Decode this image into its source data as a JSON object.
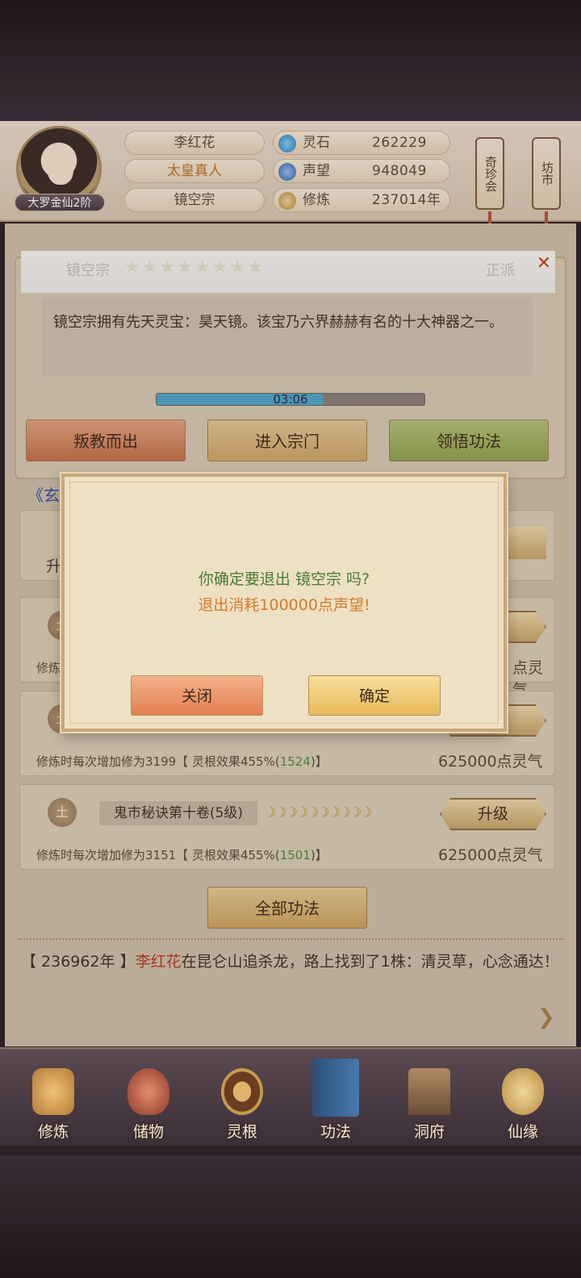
{
  "profile": {
    "rank": "大罗金仙2阶",
    "name": "李红花",
    "title": "太皇真人",
    "sect": "镜空宗"
  },
  "stats": [
    {
      "label": "灵石",
      "value": "262229",
      "icon": "spirit-stone-icon",
      "color": "#3b8fc9"
    },
    {
      "label": "声望",
      "value": "948049",
      "icon": "reputation-icon",
      "color": "#2e5fa8"
    },
    {
      "label": "修炼",
      "value": "237014年",
      "icon": "meditation-icon",
      "color": "#c69a4a"
    }
  ],
  "scrolls": {
    "market_rare": "奇珍会",
    "market": "坊市"
  },
  "sect_popup": {
    "name": "镜空宗",
    "stars": "★★★★★★★★",
    "alignment": "正派",
    "description": "镜空宗拥有先天灵宝：昊天镜。该宝乃六界赫赫有名的十大神器之一。",
    "timer": "03:06",
    "timer_progress": 0.62
  },
  "actions": {
    "betray": "叛教而出",
    "enter": "进入宗门",
    "comprehend": "领悟功法"
  },
  "link_text": "《玄",
  "skills": [
    {
      "emblem": "土",
      "name": "",
      "moons": "",
      "upgrade": "升级",
      "desc_prefix": "修炼时",
      "desc_green": "",
      "desc_suffix": "",
      "cost": "点灵气"
    },
    {
      "emblem": "土",
      "name": "",
      "moons": "",
      "upgrade": "",
      "desc_prefix": "修炼时每次增加修为3199【 灵根效果455%(",
      "desc_green": "1524",
      "desc_suffix": ")】",
      "cost": "625000点灵气"
    },
    {
      "emblem": "土",
      "name": "鬼市秘诀第十卷(5级)",
      "moons": "☽☽☽☽☽☽☽☽☽☽",
      "upgrade": "升级",
      "desc_prefix": "修炼时每次增加修为3151【 灵根效果455%(",
      "desc_green": "1501",
      "desc_suffix": ")】",
      "cost": "625000点灵气"
    }
  ],
  "partial": {
    "left_char": "升",
    "right_level": "级"
  },
  "all_skills": "全部功法",
  "log": {
    "year": "【 236962年 】",
    "name": "李红花",
    "text": "在昆仑山追杀龙，路上找到了1株：清灵草，心念通达！"
  },
  "dialog": {
    "question": "你确定要退出 镜空宗 吗?",
    "cost": "退出消耗100000点声望!",
    "close": "关闭",
    "confirm": "确定"
  },
  "nav": [
    {
      "label": "修炼",
      "icon": "cultivation-icon",
      "color": "#c8924a"
    },
    {
      "label": "储物",
      "icon": "storage-bag-icon",
      "color": "#b45a3a"
    },
    {
      "label": "灵根",
      "icon": "spirit-root-icon",
      "color": "#7a4a2a"
    },
    {
      "label": "功法",
      "icon": "skill-book-icon",
      "color": "#3a5e8c"
    },
    {
      "label": "洞府",
      "icon": "cave-dwelling-icon",
      "color": "#8a6a4a"
    },
    {
      "label": "仙缘",
      "icon": "gourd-icon",
      "color": "#c9a354"
    }
  ]
}
